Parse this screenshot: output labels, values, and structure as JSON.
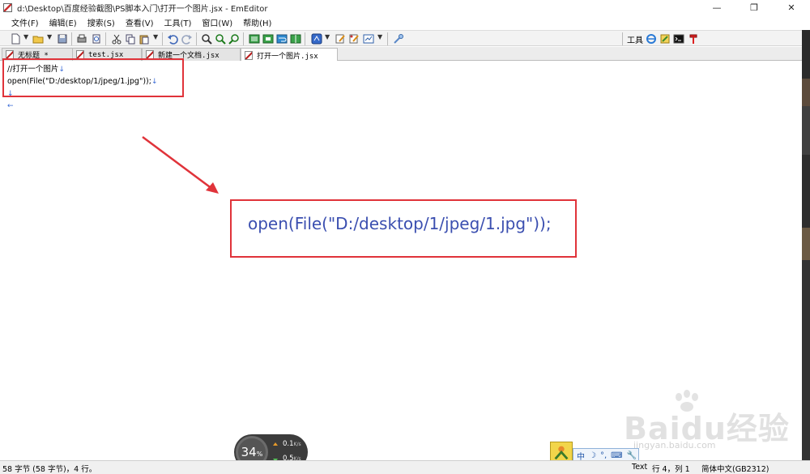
{
  "window": {
    "title": "d:\\Desktop\\百度经验截图\\PS脚本入门\\打开一个图片.jsx - EmEditor",
    "minimize": "—",
    "maximize": "❐",
    "close": "✕"
  },
  "menu": [
    {
      "label": "文件(F)"
    },
    {
      "label": "编辑(E)"
    },
    {
      "label": "搜索(S)"
    },
    {
      "label": "查看(V)"
    },
    {
      "label": "工具(T)"
    },
    {
      "label": "窗口(W)"
    },
    {
      "label": "帮助(H)"
    }
  ],
  "toolbar": {
    "tools_label": "工具"
  },
  "tabs": [
    {
      "label": "无标题 *"
    },
    {
      "label": "test.jsx"
    },
    {
      "label": "新建一个文档.jsx"
    },
    {
      "label": "打开一个图片.jsx"
    }
  ],
  "editor": {
    "lines": [
      "//打开一个图片",
      "open(File(\"D:/desktop/1/jpeg/1.jpg\"));"
    ],
    "newline_mark": "↓",
    "eof_mark": "←"
  },
  "callout": {
    "text": "open(File(\"D:/desktop/1/jpeg/1.jpg\"));"
  },
  "status": {
    "left": "58 字节 (58 字节)，4 行。",
    "mode": "Text",
    "position": "行 4，列 1",
    "encoding": "简体中文(GB2312)"
  },
  "netmon": {
    "percent": "34",
    "percent_sign": "%",
    "up_value": "0.1",
    "up_unit": "K/s",
    "down_value": "0.5",
    "down_unit": "K/s"
  },
  "ime": {
    "mode": "中",
    "moon": "☽",
    "punct": "°,",
    "keyboard": "⌨",
    "tool": "🔧"
  },
  "watermark": {
    "text": "Baidu经验",
    "sub": "jingyan.baidu.com"
  },
  "colors": {
    "annotation_red": "#e0333a",
    "callout_text": "#3b4fb0",
    "newline_mark": "#3a6bd6"
  }
}
